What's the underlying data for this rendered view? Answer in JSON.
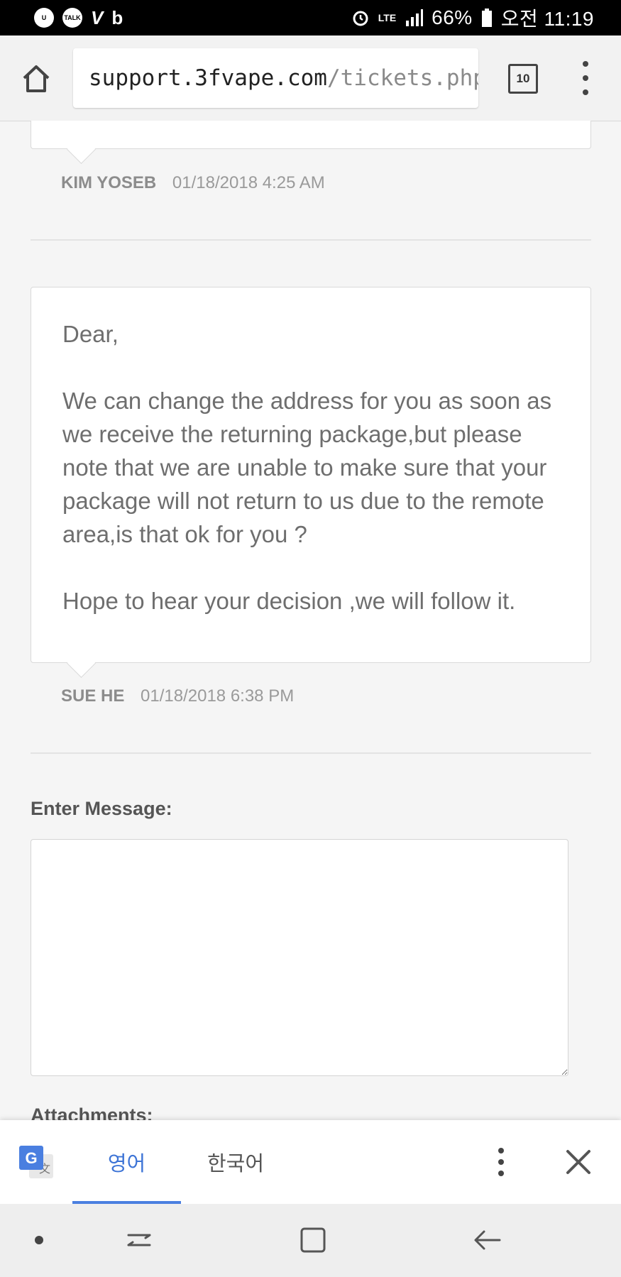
{
  "status_bar": {
    "left_icons": [
      "samsung-icon",
      "kakaotalk-icon",
      "vk-icon",
      "band-icon"
    ],
    "talk_label": "TALK",
    "network": "LTE",
    "battery": "66%",
    "time": "오전 11:19"
  },
  "browser": {
    "url_domain": "support.3fvape.com",
    "url_path": "/tickets.php?",
    "tab_count": "10"
  },
  "thread": {
    "messages": [
      {
        "author": "KIM YOSEB",
        "timestamp": "01/18/2018 4:25 AM"
      },
      {
        "author": "SUE HE",
        "timestamp": "01/18/2018 6:38 PM",
        "paragraphs": [
          "Dear,",
          "We can change the address for you as soon as we receive the returning package,but please note that we are unable to make sure that your package will not return to us due to the remote area,is that ok for you ?",
          "Hope to hear your decision ,we will follow it."
        ]
      }
    ]
  },
  "form": {
    "message_label": "Enter Message:",
    "attachments_label": "Attachments:"
  },
  "translate_bar": {
    "source_language": "영어",
    "target_language": "한국어",
    "accent_color": "#4a7fe0"
  },
  "nav_bar": {
    "items": [
      "dot",
      "recents",
      "home",
      "back"
    ]
  }
}
